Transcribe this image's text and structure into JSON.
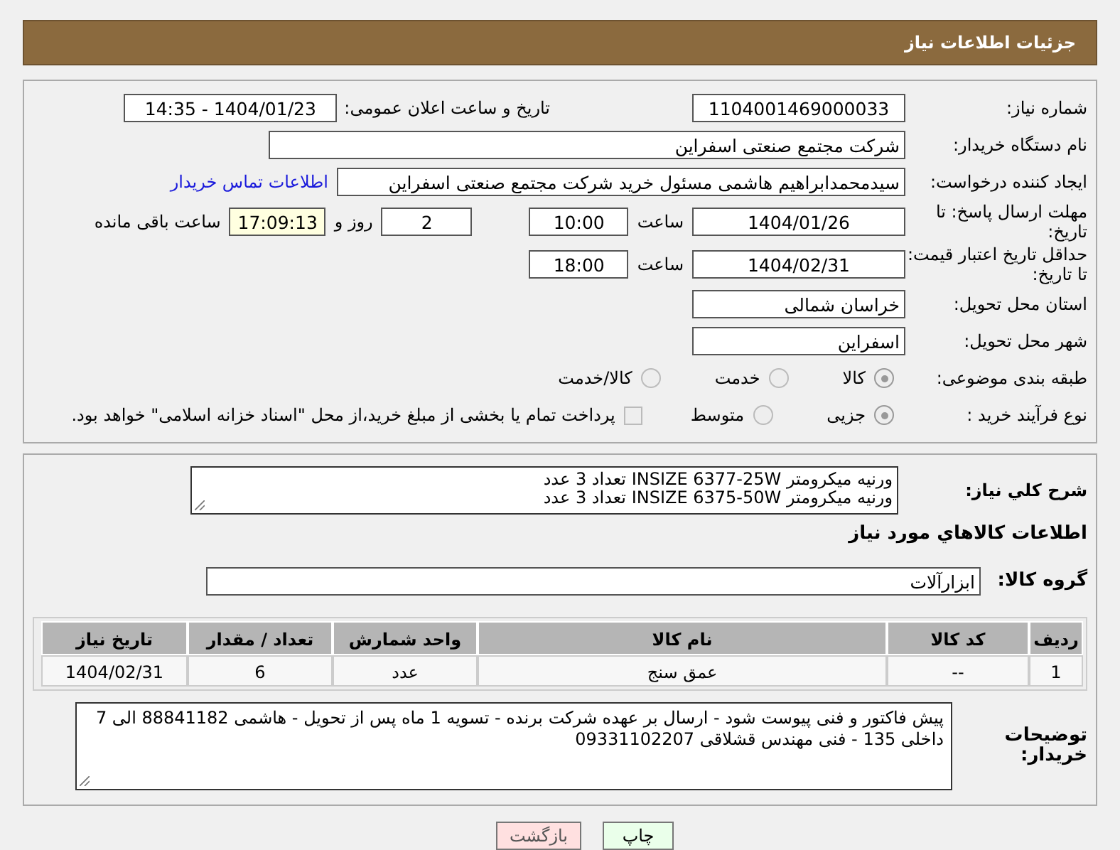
{
  "page_title": "جزئیات اطلاعات نیاز",
  "need_number": {
    "label": "شماره نیاز:",
    "value": "1104001469000033"
  },
  "announce": {
    "label": "تاریخ و ساعت اعلان عمومی:",
    "value": "1404/01/23 - 14:35"
  },
  "buyer_org": {
    "label": "نام دستگاه خریدار:",
    "value": "شرکت مجتمع صنعتی اسفراین"
  },
  "requester": {
    "label": "ایجاد کننده درخواست:",
    "value": "سیدمحمدابراهیم هاشمی مسئول خرید شرکت مجتمع صنعتی اسفراین",
    "link": "اطلاعات تماس خریدار"
  },
  "reply_deadline": {
    "label": "مهلت ارسال پاسخ: تا تاریخ:",
    "date": "1404/01/26",
    "time_label": "ساعت",
    "time": "10:00",
    "days": "2",
    "days_label": "روز و",
    "remaining": "17:09:13",
    "remaining_label": "ساعت باقی مانده"
  },
  "price_validity": {
    "label": "حداقل تاریخ اعتبار قیمت: تا تاریخ:",
    "date": "1404/02/31",
    "time_label": "ساعت",
    "time": "18:00"
  },
  "province": {
    "label": "استان محل تحویل:",
    "value": "خراسان شمالی"
  },
  "city": {
    "label": "شهر محل تحویل:",
    "value": "اسفراین"
  },
  "category": {
    "label": "طبقه بندی موضوعی:",
    "options": [
      {
        "label": "کالا",
        "selected": true
      },
      {
        "label": "خدمت",
        "selected": false
      },
      {
        "label": "کالا/خدمت",
        "selected": false
      }
    ]
  },
  "process": {
    "label": "نوع فرآیند خرید :",
    "options": [
      {
        "label": "جزیی",
        "selected": true
      },
      {
        "label": "متوسط",
        "selected": false
      }
    ],
    "payment": {
      "label": "پرداخت تمام یا بخشی از مبلغ خرید،از محل \"اسناد خزانه اسلامی\" خواهد بود.",
      "checked": false
    }
  },
  "description": {
    "label": "شرح کلي نیاز:",
    "lines": [
      "ورنیه میکرومتر INSIZE 6377-25W تعداد 3 عدد",
      "ورنیه میکرومتر INSIZE 6375-50W تعداد 3 عدد"
    ]
  },
  "goods_heading": "اطلاعات کالاهاي مورد نیاز",
  "goods_group": {
    "label": "گروه کالا:",
    "value": "ابزارآلات"
  },
  "table": {
    "columns": [
      "ردیف",
      "کد کالا",
      "نام کالا",
      "واحد شمارش",
      "تعداد / مقدار",
      "تاریخ نیاز"
    ],
    "rows": [
      [
        "1",
        "--",
        "عمق سنج",
        "عدد",
        "6",
        "1404/02/31"
      ]
    ]
  },
  "buyer_notes": {
    "label": "توضیحات خریدار:",
    "value": "پیش فاکتور و فنی پیوست شود - ارسال بر عهده شرکت برنده - تسویه 1 ماه پس از تحویل - هاشمی 88841182 الی 7 داخلی 135 - فنی مهندس قشلاقی 09331102207"
  },
  "buttons": [
    {
      "label": "چاپ",
      "kind": "print"
    },
    {
      "label": "بازگشت",
      "kind": "back"
    }
  ]
}
